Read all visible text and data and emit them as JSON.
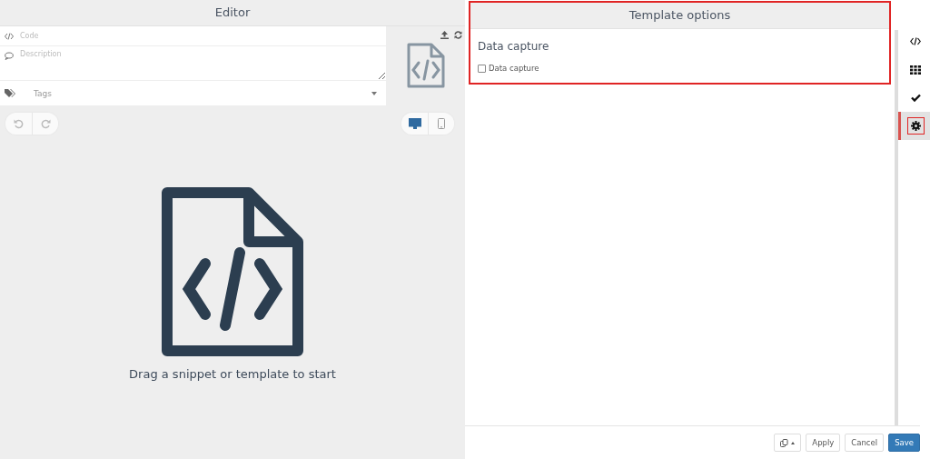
{
  "editor": {
    "title": "Editor",
    "code_placeholder": "Code",
    "description_placeholder": "Description",
    "tags_placeholder": "Tags",
    "device_buttons": [
      {
        "kind": "desktop",
        "selected": true
      },
      {
        "kind": "mobile",
        "selected": false
      }
    ],
    "empty_message": "Drag a snippet or template to start"
  },
  "options_panel": {
    "title": "Template options",
    "highlighted": true,
    "section_title": "Data capture",
    "checkbox": {
      "label": "Data capture",
      "checked": false
    }
  },
  "sidebar": [
    {
      "kind": "code",
      "selected": false,
      "highlighted": false
    },
    {
      "kind": "grid",
      "selected": false,
      "highlighted": false
    },
    {
      "kind": "check",
      "selected": false,
      "highlighted": false
    },
    {
      "kind": "gear",
      "selected": true,
      "highlighted": true
    }
  ],
  "footer": {
    "buttons": [
      {
        "label": "Apply",
        "kind": "default"
      },
      {
        "label": "Cancel",
        "kind": "default"
      },
      {
        "label": "Save",
        "kind": "primary"
      }
    ]
  }
}
